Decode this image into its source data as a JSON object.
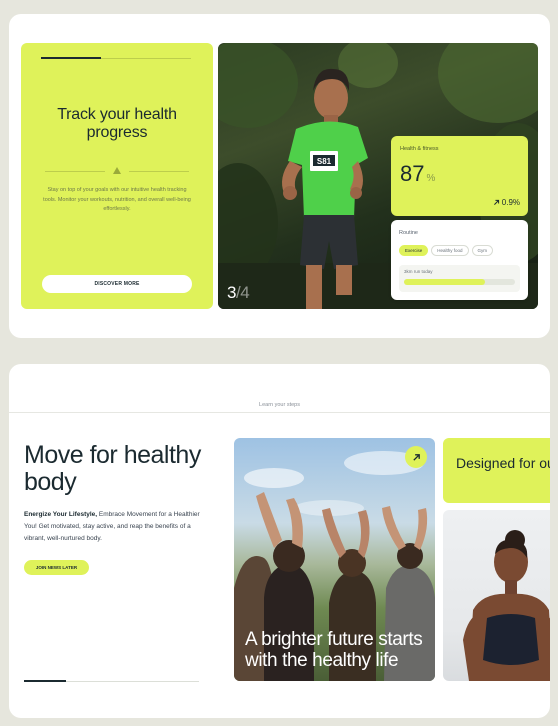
{
  "top_card": {
    "title": "Track your health progress",
    "description": "Stay on top of your goals with our intuitive health tracking tools. Monitor your workouts, nutrition, and overall well-being effortlessly.",
    "discover_button": "DISCOVER MORE",
    "slide_progress": 0.4,
    "slide_current": "3",
    "slide_total": "/4",
    "runner_bib": "S81",
    "stat": {
      "label": "Health & fitness",
      "value": "87",
      "unit": "%",
      "delta": "0.9%"
    },
    "routine": {
      "label": "Routine",
      "tabs": [
        "Exercise",
        "Healthy food",
        "Gym"
      ],
      "active_tab": "Exercise",
      "sub_label": "3km run today",
      "progress": 0.73
    }
  },
  "bottom_card": {
    "section_label": "Learn your steps",
    "title": "Move for healthy body",
    "desc_bold": "Energize Your Lifestyle,",
    "desc_rest": " Embrace Movement for a Healthier You! Get motivated, stay active, and reap the benefits of a vibrant, well-nurtured body.",
    "join_button": "JOIN NEWS LATER",
    "slide_progress": 0.24,
    "hearts_caption": "A brighter future starts with the healthy life",
    "community_text": "Designed for our community act"
  },
  "colors": {
    "accent": "#dff25a",
    "background": "#e6e6dd",
    "dark": "#1b2a30"
  },
  "icons": {
    "arrow_up_right": "arrow-up-right-icon",
    "triangle": "triangle-icon"
  }
}
